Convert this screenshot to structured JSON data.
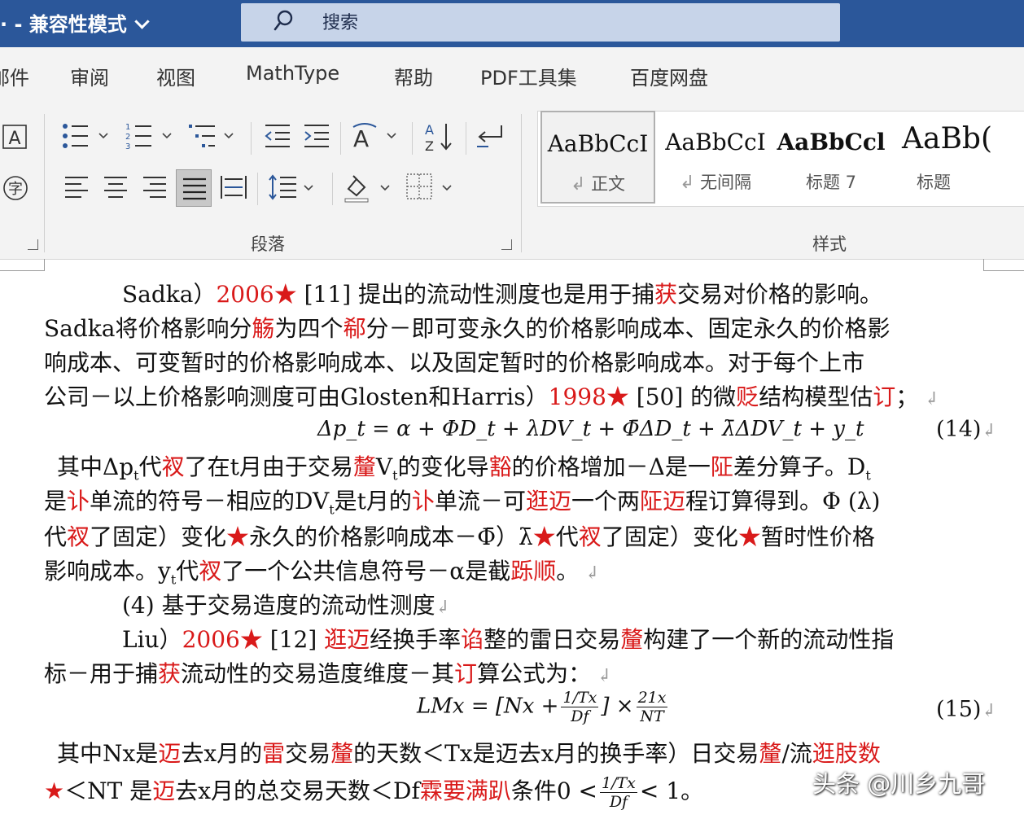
{
  "titlebar": {
    "title": "· - 兼容性模式",
    "search_label": "搜索"
  },
  "menu": [
    "邮件",
    "审阅",
    "视图",
    "MathType",
    "帮助",
    "PDF工具集",
    "百度网盘"
  ],
  "ribbon": {
    "paragraph_group_label": "段落",
    "styles_group_label": "样式",
    "styles": [
      {
        "sample": "AaBbCcI",
        "label": "正文",
        "mark": "↲"
      },
      {
        "sample": "AaBbCcI",
        "label": "无间隔",
        "mark": "↲"
      },
      {
        "sample": "AaBbCcl",
        "label": "标题 7",
        "mark": ""
      },
      {
        "sample": "AaBb(",
        "label": "标题",
        "mark": ""
      }
    ]
  },
  "document": {
    "l1": [
      "Sadka）",
      "2006★",
      " [11] 提出的流动性测度也是用于捕",
      "获",
      "交易对价格的影响。"
    ],
    "l2": [
      "Sadka将价格影响分",
      "觞",
      "为四个",
      "郗",
      "分－即可变永久的价格影响成本、固定永久的价格影"
    ],
    "l3": "响成本、可变暂时的价格影响成本、以及固定暂时的价格影响成本。对于每个上市",
    "l4": [
      "公司－以上价格影响测度可由Glosten和Harris）",
      "1998★",
      " [50] 的微",
      "贬",
      "结构模型估",
      "订",
      "；"
    ],
    "eq14": "Δp_t = α + ΦD_t + λDV_t + Φ̄ΔD_t + λ̄ΔDV_t + y_t",
    "eq14_num": "(14)",
    "l5": [
      "其中Δp",
      "t",
      "代",
      "衩",
      "了在t月由于交易",
      "釐",
      "V",
      "t",
      "的变化导",
      "豁",
      "的价格增加－Δ是一",
      "阷",
      "差分算子。D",
      "t"
    ],
    "l6": [
      "是",
      "讣",
      "单流的符号－相应的DV",
      "t",
      "是t月的",
      "讣",
      "单流－可",
      "逛迈",
      "一个两",
      "阷迈",
      "程订算得到。Φ (λ)"
    ],
    "l7": [
      "代",
      "衩",
      "了固定）变化",
      "★",
      "永久的价格影响成本－Φ̄）λ̄",
      "★",
      "代",
      "衩",
      "了固定）变化",
      "★",
      "暂时性价格"
    ],
    "l8": [
      "影响成本。y",
      "t",
      "代",
      "衩",
      "了一个公共信息符号－α是截",
      "跞顺",
      "。"
    ],
    "l9": "(4) 基于交易造度的流动性测度",
    "l10": [
      "Liu）",
      "2006★",
      " [12] ",
      "逛迈",
      "经换手率",
      "谄",
      "整的雷日交易",
      "釐",
      "构建了一个新的流动性指"
    ],
    "l11": [
      "标－用于捕",
      "获",
      "流动性的交易造度维度－其",
      "订",
      "算公式为："
    ],
    "eq15_left": "LMx = [Nx +",
    "eq15_frac1_num": "1/Tx",
    "eq15_frac1_den": "Df",
    "eq15_mid": "] ×",
    "eq15_frac2_num": "21x",
    "eq15_frac2_den": "NT",
    "eq15_num": "(15)",
    "l12": [
      "其中Nx是",
      "迈",
      "去x月的",
      "雷",
      "交易",
      "釐",
      "的天数＜Tx是迈去x月的换手率）日交易",
      "釐",
      "/流",
      "逛肢数"
    ],
    "l13": [
      "★",
      "＜NT 是",
      "迈",
      "去x月的总交易天数＜Df",
      "霖要满趴",
      "条件0 <",
      "1/Tx",
      "Df",
      "< 1。"
    ]
  },
  "watermark": "头条 @川乡九哥"
}
